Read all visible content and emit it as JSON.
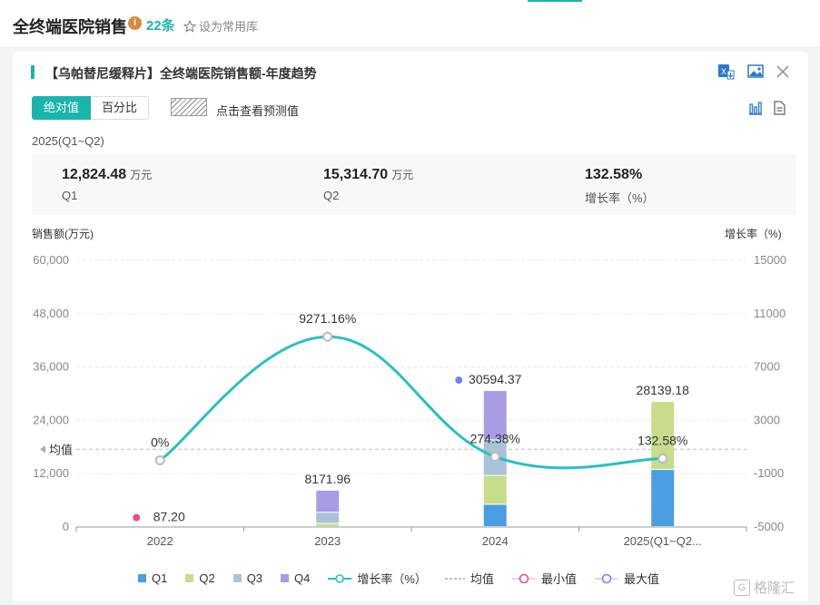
{
  "header": {
    "title": "全终端医院销售",
    "info_icon": "i",
    "count": "22条",
    "favorite_label": "设为常用库"
  },
  "card": {
    "title": "【乌帕替尼缓释片】全终端医院销售额-年度趋势",
    "toolbar_icons": [
      "excel-export-icon",
      "image-export-icon",
      "close-icon",
      "bar-chart-view-icon",
      "table-view-icon"
    ],
    "tabs": [
      "绝对值",
      "百分比"
    ],
    "active_tab": "绝对值",
    "forecast_label": "点击查看预测值",
    "period": "2025(Q1~Q2)",
    "stats": [
      {
        "value": "12,824.48",
        "unit": "万元",
        "label": "Q1"
      },
      {
        "value": "15,314.70",
        "unit": "万元",
        "label": "Q2"
      },
      {
        "value": "132.58%",
        "unit": "",
        "label": "增长率（%）"
      }
    ]
  },
  "colors": {
    "accent": "#19b5aa",
    "q1": "#4a9de0",
    "q2": "#c8dc8c",
    "q3": "#a9c2d8",
    "q4": "#a99be6",
    "growth": "#2bbfbf",
    "min_dot": "#e84a8a",
    "max_dot": "#7b7ee8"
  },
  "chart_data": {
    "type": "bar",
    "stacked": true,
    "ylabel": "销售额(万元)",
    "y2label": "增长率（%)",
    "ylim": [
      0,
      60000
    ],
    "y2lim": [
      -5000,
      15000
    ],
    "yticks": [
      "60,000",
      "48,000",
      "36,000",
      "24,000",
      "12,000",
      "0"
    ],
    "y2ticks": [
      "15000",
      "11000",
      "7000",
      "3000",
      "-1000",
      "-5000"
    ],
    "categories": [
      "2022",
      "2023",
      "2024",
      "2025(Q1~Q2..."
    ],
    "series": [
      {
        "name": "Q1",
        "values": [
          0,
          0,
          5000,
          12824.48
        ]
      },
      {
        "name": "Q2",
        "values": [
          0,
          700,
          6500,
          15314.7
        ]
      },
      {
        "name": "Q3",
        "values": [
          0,
          2500,
          8000,
          0
        ]
      },
      {
        "name": "Q4",
        "values": [
          87.2,
          4971.96,
          11094.37,
          0
        ]
      }
    ],
    "totals": [
      "87.20",
      "8171.96",
      "30594.37",
      "28139.18"
    ],
    "growth": {
      "name": "增长率（%）",
      "values": [
        0,
        9271.16,
        274.38,
        132.58
      ],
      "labels": [
        "0%",
        "9271.16%",
        "274.38%",
        "132.58%"
      ]
    },
    "mean_label": "均值",
    "mean_value": 17500,
    "legend": [
      "Q1",
      "Q2",
      "Q3",
      "Q4",
      "增长率（%）",
      "均值",
      "最小值",
      "最大值"
    ]
  },
  "watermark": {
    "icon": "G",
    "text": "格隆汇"
  }
}
